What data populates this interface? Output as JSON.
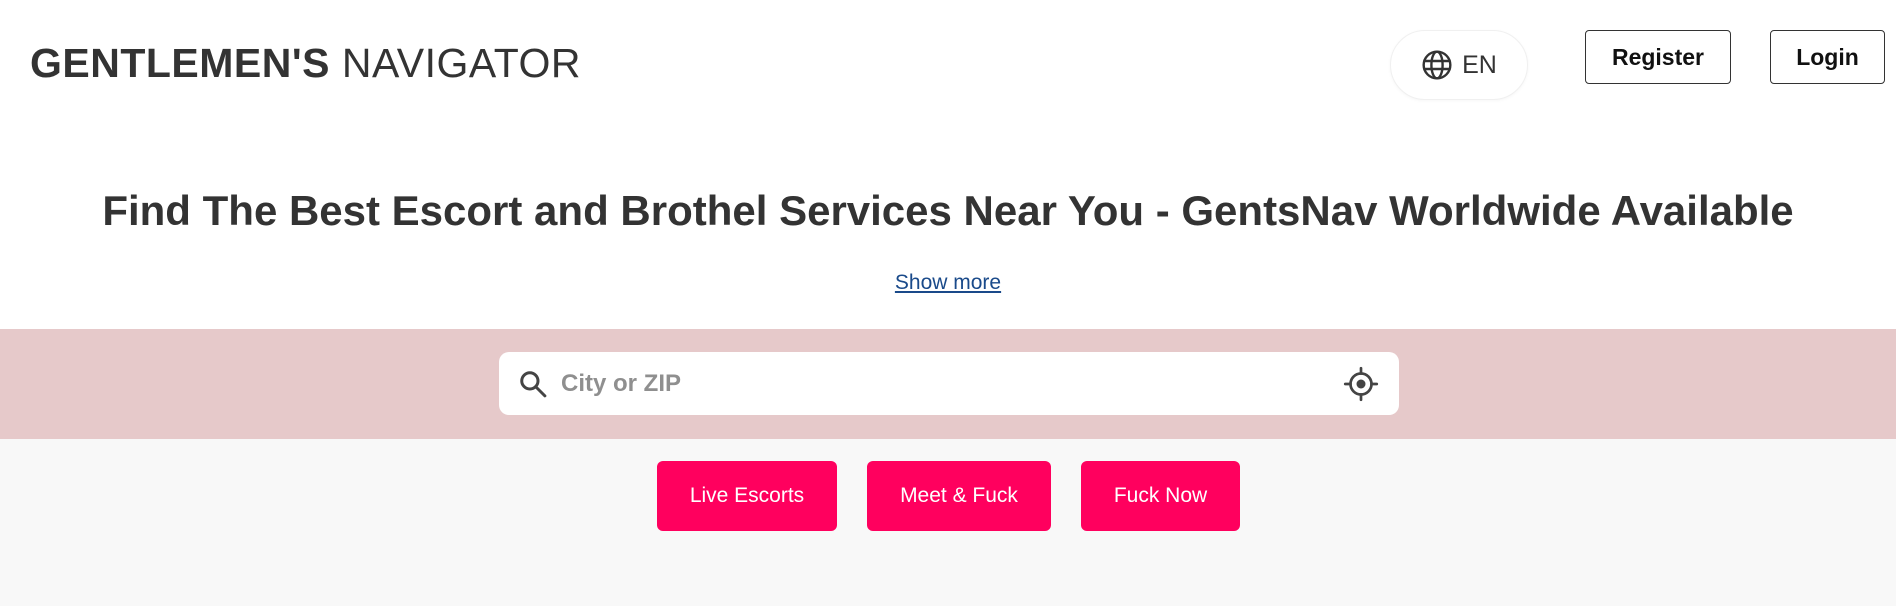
{
  "header": {
    "logo": {
      "strong": "GENTLEMEN'S",
      "light": " NAVIGATOR"
    },
    "language": {
      "label": "EN",
      "icon": "globe-icon"
    },
    "register_label": "Register",
    "login_label": "Login"
  },
  "hero": {
    "headline": "Find The Best Escort and Brothel Services Near You - GentsNav Worldwide Available",
    "show_more_label": "Show more"
  },
  "search": {
    "placeholder": "City or ZIP",
    "value": "",
    "search_icon": "search-icon",
    "locate_icon": "crosshair-icon"
  },
  "categories": [
    {
      "label": "Live Escorts"
    },
    {
      "label": "Meet & Fuck"
    },
    {
      "label": "Fuck Now"
    }
  ],
  "colors": {
    "accent": "#ff005e",
    "search_band": "#e6c9ca",
    "text": "#333333",
    "link": "#1a4a8a",
    "category_area": "#f8f8f8"
  }
}
